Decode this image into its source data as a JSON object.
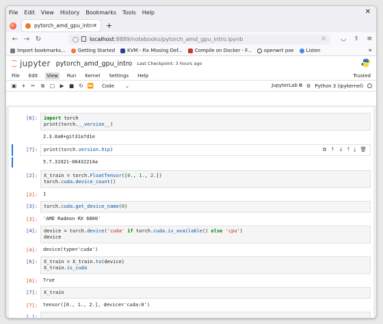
{
  "browser": {
    "menu": [
      "File",
      "Edit",
      "View",
      "History",
      "Bookmarks",
      "Tools",
      "Help"
    ],
    "tab_title": "pytorch_amd_gpu_intro",
    "url_host": "localhost",
    "url_path": ":8889/notebooks/pytorch_amd_gpu_intro.ipynb",
    "bookmarks": [
      "Import bookmarks...",
      "Getting Started",
      "KVM - Fix Missing Def...",
      "Compile on Docker - F...",
      "openwrt pxe",
      "Listen"
    ]
  },
  "jupyter": {
    "logo_text": "jupyter",
    "notebook_name": "pytorch_amd_gpu_intro",
    "checkpoint": "Last Checkpoint: 3 hours ago",
    "menu": [
      "File",
      "Edit",
      "View",
      "Run",
      "Kernel",
      "Settings",
      "Help"
    ],
    "trusted": "Trusted",
    "cell_type": "Code",
    "jupyterlab_label": "JupyterLab",
    "kernel_name": "Python 3 (ipykernel)"
  },
  "cells": {
    "c6_in_prompt": "[6]:",
    "c6_out": "2.3.0a0+git31a7d1e",
    "c7_in_prompt": "[7]:",
    "c7_out": "5.7.31921-06432214a",
    "c2_in_prompt": "[2]:",
    "c2_out_prompt": "[2]:",
    "c2_out": "1",
    "c3_in_prompt": "[3]:",
    "c3_out_prompt": "[3]:",
    "c3_out": "'AMD Radeon RX 6800'",
    "c4_in_prompt": "[4]:",
    "c4_out_prompt": "[4]:",
    "c4_out": "device(type='cuda')",
    "c5_in_prompt": "[6]:",
    "c5_out_prompt": "[6]:",
    "c5_out": "True",
    "c8_in_prompt": "[7]:",
    "c8_code": "X_train",
    "c8_out_prompt": "[7]:",
    "c8_out": "tensor([0., 1., 2.], device='cuda:0')",
    "empty_prompt": "[ ]:"
  },
  "code_tokens": {
    "import": "import",
    "torch": " torch",
    "print_ver_a": "print(torch.",
    "print_ver_b": "__version__",
    "print_ver_c": ")",
    "hip_a": "print(torch.",
    "hip_b": "version",
    "hip_c": ".",
    "hip_d": "hip",
    "hip_e": ")",
    "ft_a": "X_train = torch.",
    "ft_b": "FloatTensor",
    "ft_c": "([",
    "ft_d": "0.",
    "ft_e": ", ",
    "ft_f": "1.",
    "ft_g": ", ",
    "ft_h": "2.",
    "ft_i": "])",
    "dc_a": "torch.",
    "dc_b": "cuda",
    "dc_c": ".",
    "dc_d": "device_count",
    "dc_e": "()",
    "gn_a": "torch.",
    "gn_b": "cuda",
    "gn_c": ".",
    "gn_d": "get_device_name",
    "gn_e": "(",
    "gn_f": "0",
    "gn_g": ")",
    "dv_a": "device = torch.",
    "dv_b": "device",
    "dv_c": "(",
    "dv_d": "'cuda'",
    "dv_e": " ",
    "dv_f": "if",
    "dv_g": " torch.",
    "dv_h": "cuda",
    "dv_i": ".",
    "dv_j": "is_available",
    "dv_k": "() ",
    "dv_l": "else",
    "dv_m": " ",
    "dv_n": "'cpu'",
    "dv_o": ")",
    "dv2": "device",
    "to_a": "X_train = X_train.",
    "to_b": "to",
    "to_c": "(device)",
    "ic_a": "X_train.",
    "ic_b": "is_cuda"
  }
}
